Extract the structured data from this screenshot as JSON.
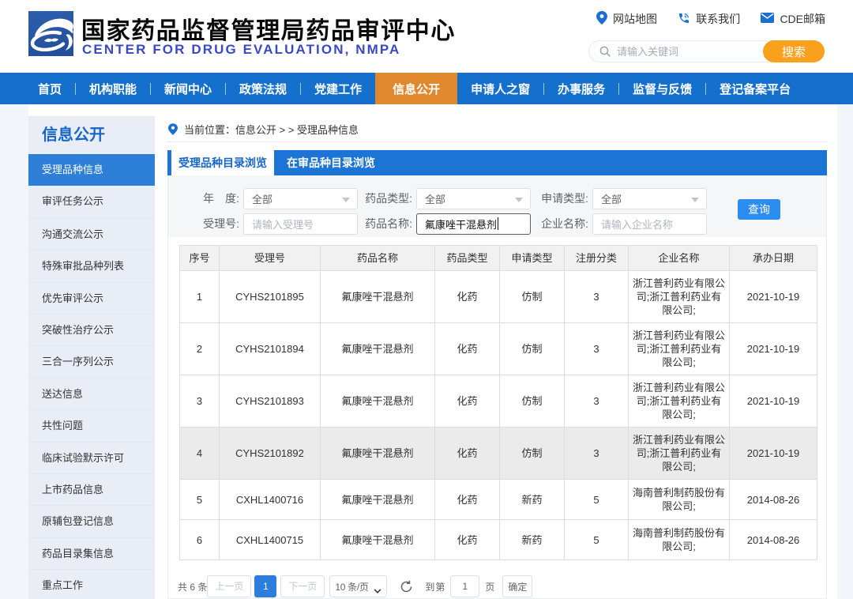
{
  "colors": {
    "nav_blue": "#1570CD",
    "nav_active_orange": "#E0882D",
    "search_button_orange": "#F9A11C",
    "sidebar_bg": "#E9EDF5",
    "sidebar_active_blue": "#2E7FD8",
    "tabbar_blue": "#1C74D4",
    "query_button_blue": "#2D8CF0",
    "pagination_active_blue": "#2D7CE0",
    "brand_subtitle_blue": "#3A49C3"
  },
  "header": {
    "title": "国家药品监督管理局药品审评中心",
    "subtitle": "CENTER FOR DRUG EVALUATION, NMPA",
    "links": [
      {
        "icon": "location-pin-icon",
        "label": "网站地图"
      },
      {
        "icon": "phone-icon",
        "label": "联系我们"
      },
      {
        "icon": "envelope-icon",
        "label": "CDE邮箱"
      }
    ],
    "search": {
      "placeholder": "请输入关键词",
      "button_label": "搜索"
    }
  },
  "nav": {
    "items": [
      "首页",
      "机构职能",
      "新闻中心",
      "政策法规",
      "党建工作",
      "信息公开",
      "申请人之窗",
      "办事服务",
      "监督与反馈",
      "登记备案平台"
    ],
    "active_index": 5
  },
  "sidebar": {
    "title": "信息公开",
    "items": [
      "受理品种信息",
      "审评任务公示",
      "沟通交流公示",
      "特殊审批品种列表",
      "优先审评公示",
      "突破性治疗公示",
      "三合一序列公示",
      "送达信息",
      "共性问题",
      "临床试验默示许可",
      "上市药品信息",
      "原辅包登记信息",
      "药品目录集信息",
      "重点工作"
    ],
    "active_index": 0
  },
  "breadcrumb": {
    "text": "当前位置：信息公开 > > 受理品种信息"
  },
  "tabs": {
    "items": [
      "受理品种目录浏览",
      "在审品种目录浏览"
    ],
    "active_index": 0
  },
  "filters": {
    "row1": [
      {
        "label": "年　度:",
        "value": "全部"
      },
      {
        "label": "药品类型:",
        "value": "全部"
      },
      {
        "label": "申请类型:",
        "value": "全部"
      }
    ],
    "row2": [
      {
        "label": "受理号:",
        "placeholder": "请输入受理号",
        "value": ""
      },
      {
        "label": "药品名称:",
        "placeholder": "",
        "value": "氟康唑干混悬剂"
      },
      {
        "label": "企业名称:",
        "placeholder": "请输入企业名称",
        "value": ""
      }
    ],
    "query_button": "查询"
  },
  "table": {
    "columns": [
      "序号",
      "受理号",
      "药品名称",
      "药品类型",
      "申请类型",
      "注册分类",
      "企业名称",
      "承办日期"
    ],
    "rows": [
      [
        "1",
        "CYHS2101895",
        "氟康唑干混悬剂",
        "化药",
        "仿制",
        "3",
        "浙江普利药业有限公司;浙江普利药业有限公司;",
        "2021-10-19"
      ],
      [
        "2",
        "CYHS2101894",
        "氟康唑干混悬剂",
        "化药",
        "仿制",
        "3",
        "浙江普利药业有限公司;浙江普利药业有限公司;",
        "2021-10-19"
      ],
      [
        "3",
        "CYHS2101893",
        "氟康唑干混悬剂",
        "化药",
        "仿制",
        "3",
        "浙江普利药业有限公司;浙江普利药业有限公司;",
        "2021-10-19"
      ],
      [
        "4",
        "CYHS2101892",
        "氟康唑干混悬剂",
        "化药",
        "仿制",
        "3",
        "浙江普利药业有限公司;浙江普利药业有限公司;",
        "2021-10-19"
      ],
      [
        "5",
        "CXHL1400716",
        "氟康唑干混悬剂",
        "化药",
        "新药",
        "5",
        "海南普利制药股份有限公司;",
        "2014-08-26"
      ],
      [
        "6",
        "CXHL1400715",
        "氟康唑干混悬剂",
        "化药",
        "新药",
        "5",
        "海南普利制药股份有限公司;",
        "2014-08-26"
      ]
    ],
    "highlighted_row_index": 3
  },
  "pagination": {
    "total_text": "共 6 条",
    "prev_label": "上一页",
    "current_page": "1",
    "next_label": "下一页",
    "page_size_label": "10 条/页",
    "goto_label": "到第",
    "goto_value": "1",
    "goto_unit": "页",
    "confirm_label": "确定"
  }
}
